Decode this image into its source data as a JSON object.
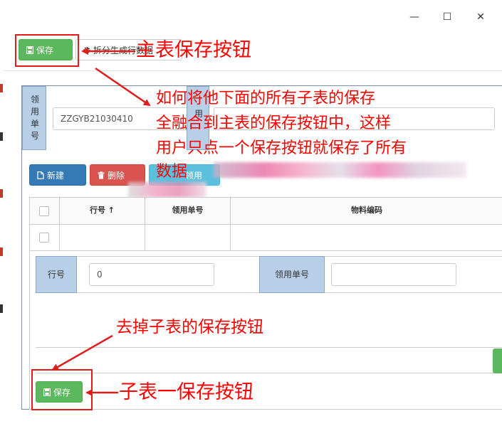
{
  "window": {
    "controls": {
      "minimize": "—",
      "maximize": "☐",
      "close": "✕"
    }
  },
  "toolbar": {
    "save_label": "保存",
    "split_label": "拆分生成行数据"
  },
  "master_form": {
    "field1_label": "领用单号",
    "field1_value": "ZZGYB21030410",
    "field2_label": "用"
  },
  "grid_toolbar": {
    "new_label": "新建",
    "delete_label": "删除",
    "third_label": "领用"
  },
  "grid": {
    "columns": [
      "行号 ↑",
      "领用单号",
      "物料编码"
    ]
  },
  "sub_form": {
    "row_no_label": "行号",
    "row_no_value": "0",
    "req_no_label": "领用单号",
    "req_no_value": "",
    "save_label": "保存"
  },
  "annotations": {
    "master_save": "主表保存按钮",
    "question_lines": [
      "如何将他下面的所有子表的保存",
      "全融合到主表的保存按钮中，这样",
      "用户只点一个保存按钮就保存了所有",
      "数据"
    ],
    "remove_sub_save": "去掉子表的保存按钮",
    "sub_save": "子表一保存按钮"
  },
  "colors": {
    "annotation_red": "#ff0000",
    "save_green": "#5cb85c",
    "new_blue": "#337ab7",
    "delete_red": "#d9534f",
    "label_blue": "#b8cfe8"
  }
}
